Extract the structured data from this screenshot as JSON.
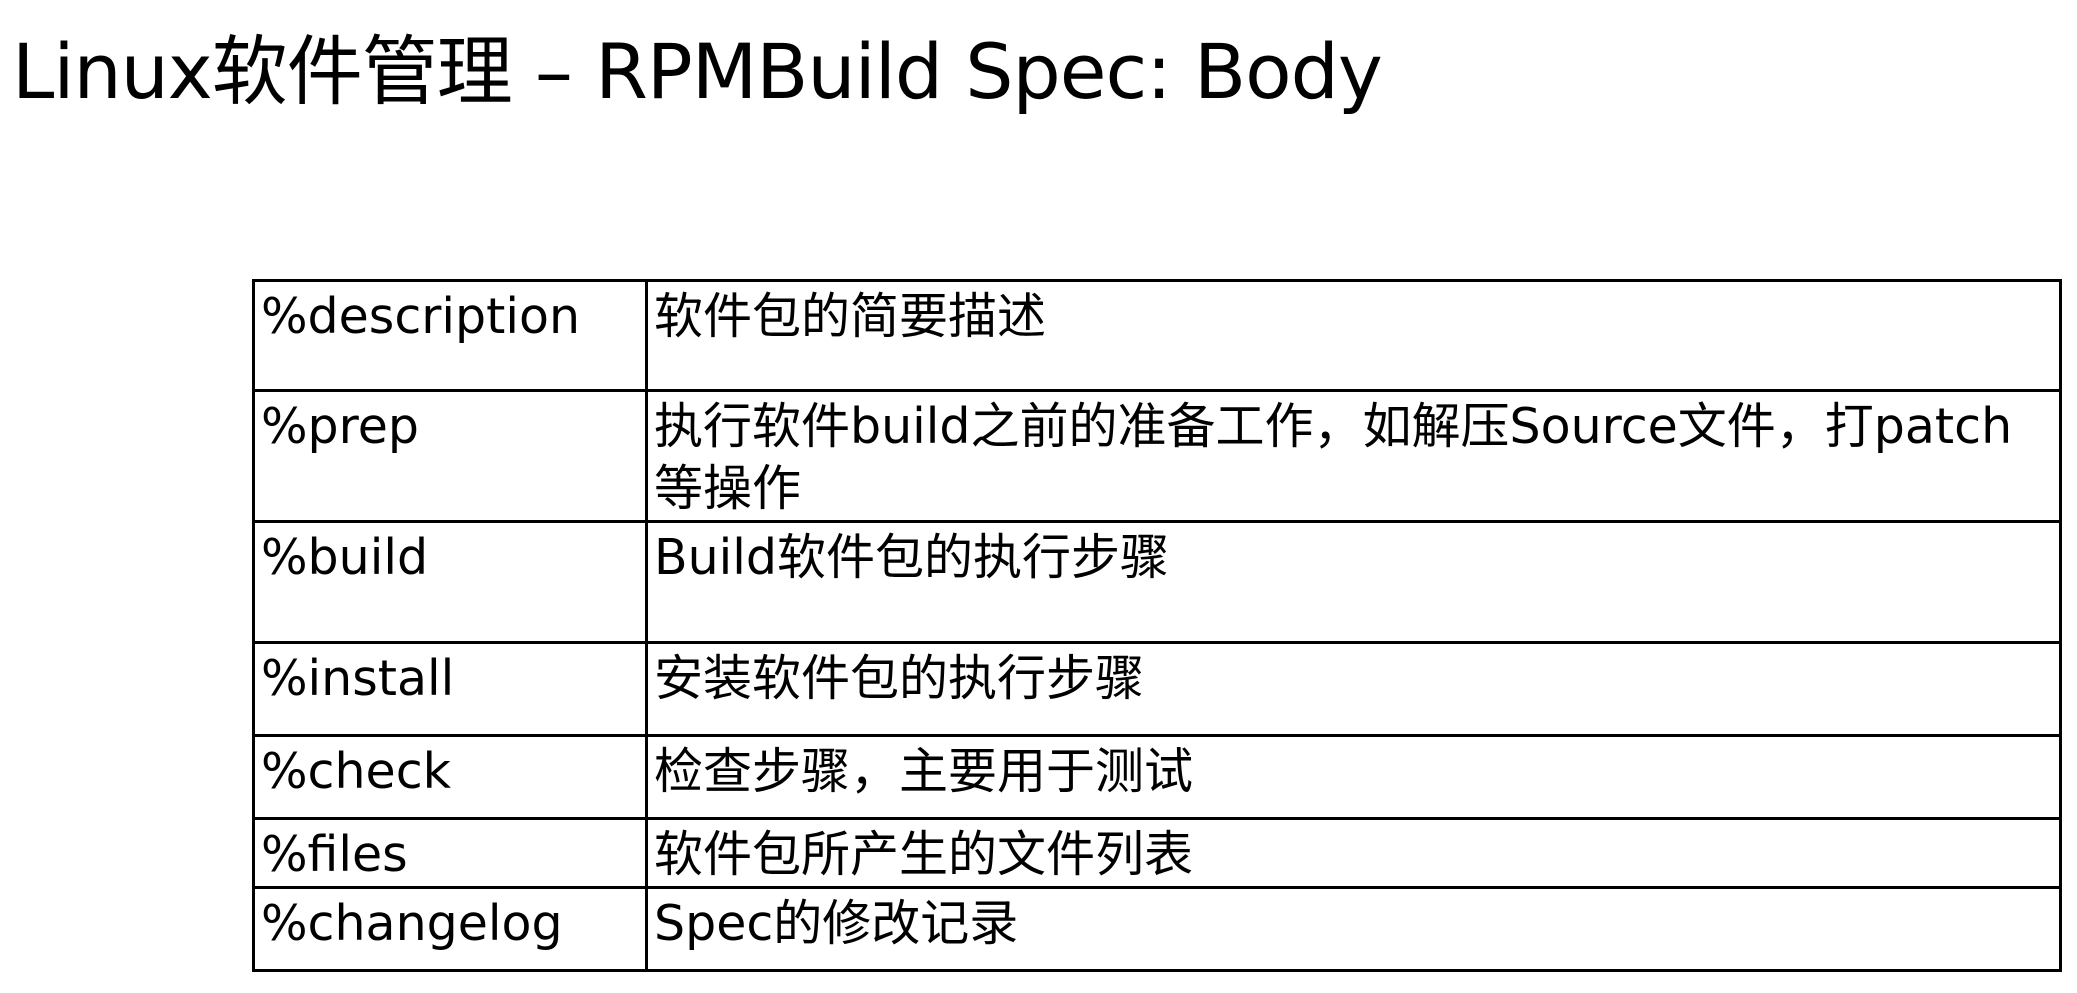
{
  "title": "Linux软件管理 – RPMBuild Spec: Body",
  "table": {
    "rows": [
      {
        "directive": "%description",
        "description": "软件包的简要描述"
      },
      {
        "directive": "%prep",
        "description": "执行软件build之前的准备工作，如解压Source文件，打patch等操作"
      },
      {
        "directive": "%build",
        "description": "Build软件包的执行步骤"
      },
      {
        "directive": "%install",
        "description": "安装软件包的执行步骤"
      },
      {
        "directive": "%check",
        "description": "检查步骤，主要用于测试"
      },
      {
        "directive": "%files",
        "description": "软件包所产生的文件列表"
      },
      {
        "directive": "%changelog",
        "description": "Spec的修改记录"
      }
    ]
  }
}
